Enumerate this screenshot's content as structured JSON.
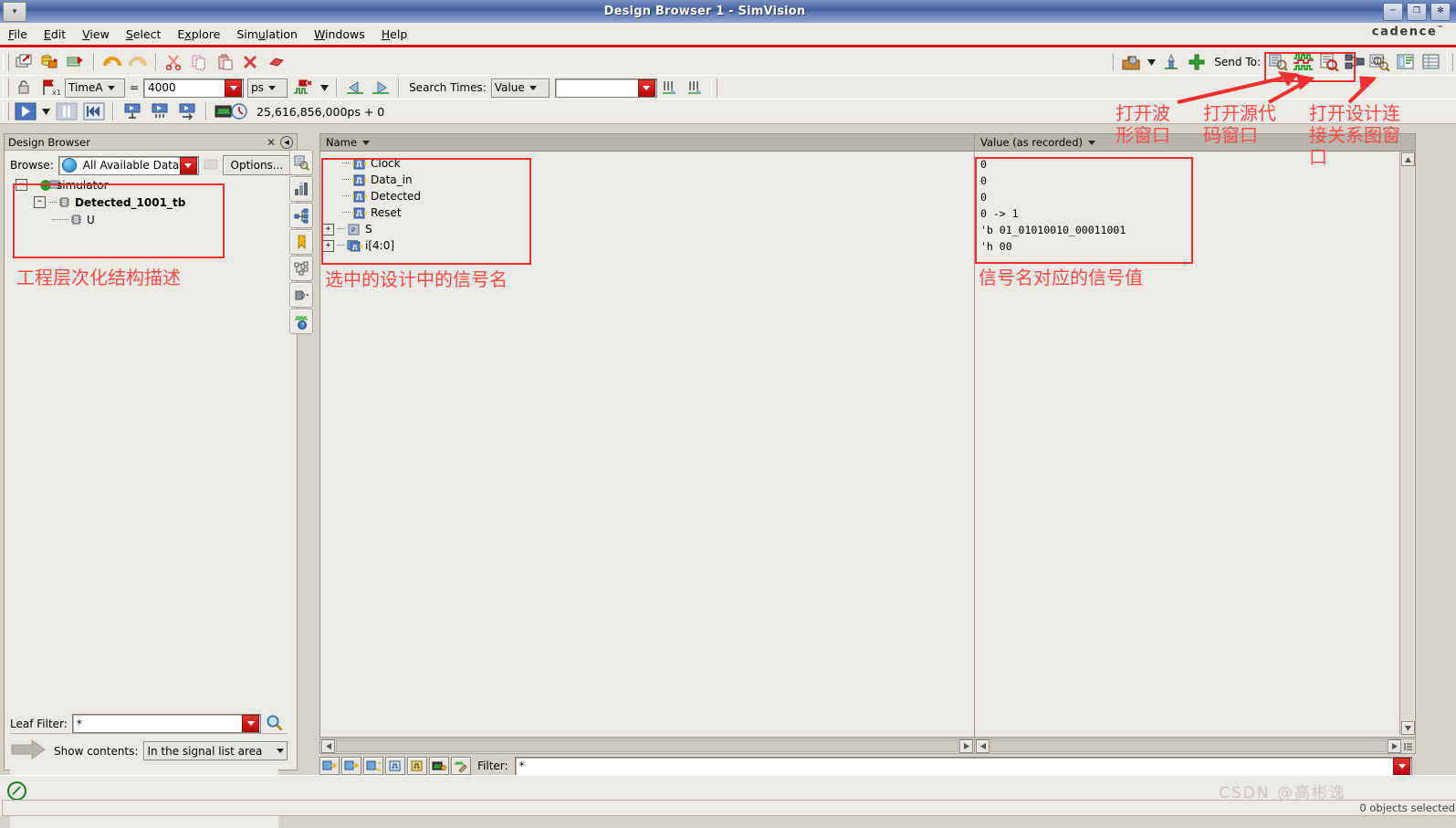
{
  "window": {
    "title": "Design Browser 1 - SimVision",
    "menu_btn": "▾",
    "buttons": {
      "minimize": "─",
      "maximize": "❐",
      "close": "✻"
    }
  },
  "menubar": {
    "items": [
      {
        "label": "File",
        "accel": "F"
      },
      {
        "label": "Edit",
        "accel": "E"
      },
      {
        "label": "View",
        "accel": "V"
      },
      {
        "label": "Select",
        "accel": "S"
      },
      {
        "label": "Explore",
        "accel": "x"
      },
      {
        "label": "Simulation",
        "accel": "u"
      },
      {
        "label": "Windows",
        "accel": "W"
      },
      {
        "label": "Help",
        "accel": "H"
      }
    ],
    "brand": "cadence",
    "brand_tm": "™"
  },
  "toolbar1": {
    "icons": [
      "new-window-icon",
      "open-database-icon",
      "reload-icon",
      "undo-icon",
      "redo-icon",
      "cut-icon",
      "copy-icon",
      "paste-icon",
      "delete-icon",
      "erase-icon"
    ],
    "right_icons": [
      "toolbox-icon",
      "dropdown-arrow-icon",
      "probe-icon",
      "add-signal-icon"
    ],
    "send_to_label": "Send To:",
    "send_to_icons": [
      "send-to-browser-icon",
      "send-to-waveform-icon",
      "send-to-source-icon",
      "send-to-schematic-icon",
      "send-to-register-icon",
      "send-to-memory-icon",
      "send-to-list-icon"
    ]
  },
  "toolbar2": {
    "lock_icon": "lock-icon",
    "marker_icon": "time-marker-icon",
    "time_name": "TimeA",
    "equals": "=",
    "time_value": "4000",
    "time_unit": "ps",
    "search_times_label": "Search Times:",
    "search_mode": "Value",
    "search_value": "",
    "search_prev_icon": "search-prev-icon",
    "search_next_icon": "search-next-icon"
  },
  "toolbar3": {
    "play_icon": "play-icon",
    "pause_icon": "pause-icon",
    "rewind_icon": "rewind-icon",
    "step_icons": [
      "step-into-icon",
      "step-over-icon",
      "step-out-icon"
    ],
    "sim_time_icon": "simulation-time-icon",
    "sim_time": "25,616,856,000ps + 0"
  },
  "design_browser": {
    "panel_title": "Design Browser",
    "close_icon": "close-icon",
    "collapse_icon": "collapse-icon",
    "browse_label": "Browse:",
    "browse_value": "All Available Data",
    "browse_globe_icon": "globe-icon",
    "filter_scope_icon": "scope-filter-icon",
    "options_label": "Options...",
    "tree": [
      {
        "label": "simulator",
        "expander": "−",
        "icon": "simulator-icon",
        "depth": 0,
        "bold": false
      },
      {
        "label": "Detected_1001_tb",
        "expander": "−",
        "icon": "module-icon",
        "depth": 1,
        "bold": true
      },
      {
        "label": "U",
        "expander": "",
        "icon": "module-icon",
        "depth": 2,
        "bold": false
      }
    ],
    "leaf_filter_label": "Leaf Filter:",
    "leaf_filter_value": "*",
    "leaf_filter_search_icon": "magnifier-icon",
    "show_contents_label": "Show contents:",
    "show_contents_value": "In the signal list area",
    "show_contents_arrow_icon": "arrow-right-icon"
  },
  "side_toolbar": {
    "icons": [
      "find-scope-icon",
      "hierarchy-icon",
      "fanout-icon",
      "bookmark-icon",
      "tree-structure-icon",
      "driver-icon",
      "waveform-help-icon"
    ]
  },
  "signal_list": {
    "column_header": "Name",
    "sort_arrow_icon": "sort-arrow-icon",
    "rows": [
      {
        "name": "Clock",
        "expander": "",
        "icon": "signal-icon"
      },
      {
        "name": "Data_in",
        "expander": "",
        "icon": "signal-icon"
      },
      {
        "name": "Detected",
        "expander": "",
        "icon": "signal-icon"
      },
      {
        "name": "Reset",
        "expander": "",
        "icon": "signal-icon"
      },
      {
        "name": "S",
        "expander": "+",
        "icon": "parameter-icon"
      },
      {
        "name": "i[4:0]",
        "expander": "+",
        "icon": "bus-icon"
      }
    ]
  },
  "value_list": {
    "column_header": "Value (as recorded)",
    "sort_arrow_icon": "sort-arrow-icon",
    "values": [
      "0",
      "0",
      "0",
      "0 -> 1",
      "'b 01_01010010_00011001",
      "'h 00"
    ]
  },
  "bottom_bar": {
    "icons": [
      "expand-all-icon",
      "collapse-all-icon",
      "next-scope-icon",
      "show-signal-icon",
      "show-bus-icon",
      "show-memory-icon",
      "edit-filter-icon"
    ],
    "filter_label": "Filter:",
    "filter_value": "*"
  },
  "statusbar": {
    "stop_icon": "stop-icon",
    "message": "0 objects selected",
    "watermark": "CSDN @高彬逸"
  },
  "annotations": {
    "color": "#fc4a4a",
    "labels": [
      {
        "text": "打开波\n形窗口"
      },
      {
        "text": "打开源代\n码窗口"
      },
      {
        "text": "打开设计连\n接关系图窗\n口"
      },
      {
        "text": "工程层次化结构描述"
      },
      {
        "text": "选中的设计中的信号名"
      },
      {
        "text": "信号名对应的信号值"
      }
    ]
  }
}
